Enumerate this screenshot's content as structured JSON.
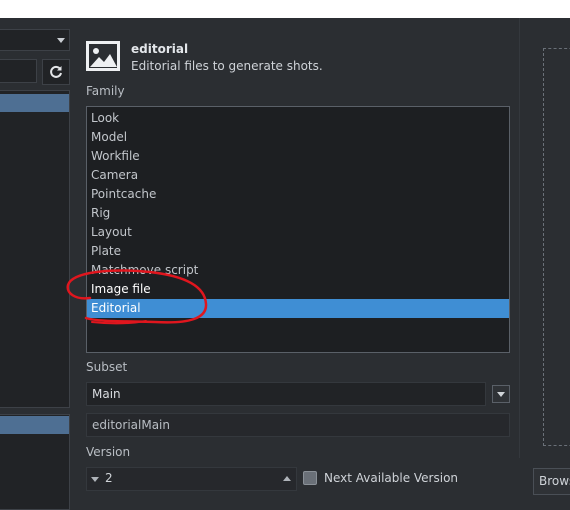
{
  "header": {
    "family_name": "editorial",
    "family_description": "Editorial files to generate shots."
  },
  "family": {
    "label": "Family",
    "items": [
      {
        "label": "Look"
      },
      {
        "label": "Model"
      },
      {
        "label": "Workfile"
      },
      {
        "label": "Camera"
      },
      {
        "label": "Pointcache"
      },
      {
        "label": "Rig"
      },
      {
        "label": "Layout"
      },
      {
        "label": "Plate"
      },
      {
        "label": "Matchmove script"
      },
      {
        "label": "Image file"
      },
      {
        "label": "Editorial"
      }
    ],
    "selected": "Editorial"
  },
  "subset": {
    "label": "Subset",
    "value": "Main",
    "result": "editorialMain"
  },
  "version": {
    "label": "Version",
    "value": "2",
    "next_available_label": "Next Available Version"
  },
  "browse_label": "Brows",
  "colors": {
    "background": "#2b2e32",
    "selection": "#3f8ed4",
    "annotation": "#e0161e"
  },
  "icons": {
    "family": "image-icon",
    "refresh": "refresh-icon"
  }
}
